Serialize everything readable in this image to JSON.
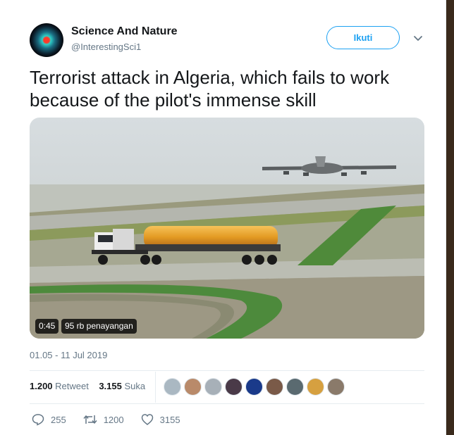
{
  "tweet": {
    "author_name": "Science And Nature",
    "author_handle": "@InterestingSci1",
    "follow_label": "Ikuti",
    "text": "Terrorist attack in Algeria, which fails to work because of the pilot's immense skill",
    "video": {
      "duration": "0:45",
      "views": "95 rb penayangan"
    },
    "timestamp": "01.05 - 11 Jul 2019"
  },
  "stats": {
    "retweets_count": "1.200",
    "retweets_label": "Retweet",
    "likes_count": "3.155",
    "likes_label": "Suka"
  },
  "likers": [
    {
      "icon": "default-avatar-icon",
      "color": "#aab8c2"
    },
    {
      "icon": "user-avatar",
      "color": "#b98a6a"
    },
    {
      "icon": "user-avatar",
      "color": "#a7b0b8"
    },
    {
      "icon": "user-avatar",
      "color": "#4a3a48"
    },
    {
      "icon": "flag-avatar",
      "color": "#1a3a8a"
    },
    {
      "icon": "user-avatar",
      "color": "#7a5a48"
    },
    {
      "icon": "user-avatar",
      "color": "#5a6a70"
    },
    {
      "icon": "user-avatar",
      "color": "#d6a040"
    },
    {
      "icon": "user-avatar",
      "color": "#8a7a6a"
    }
  ],
  "actions": {
    "reply_count": "255",
    "retweet_count": "1200",
    "like_count": "3155"
  },
  "colors": {
    "accent": "#1da1f2",
    "secondary_text": "#657786",
    "tanker_orange": "#e39a22"
  }
}
